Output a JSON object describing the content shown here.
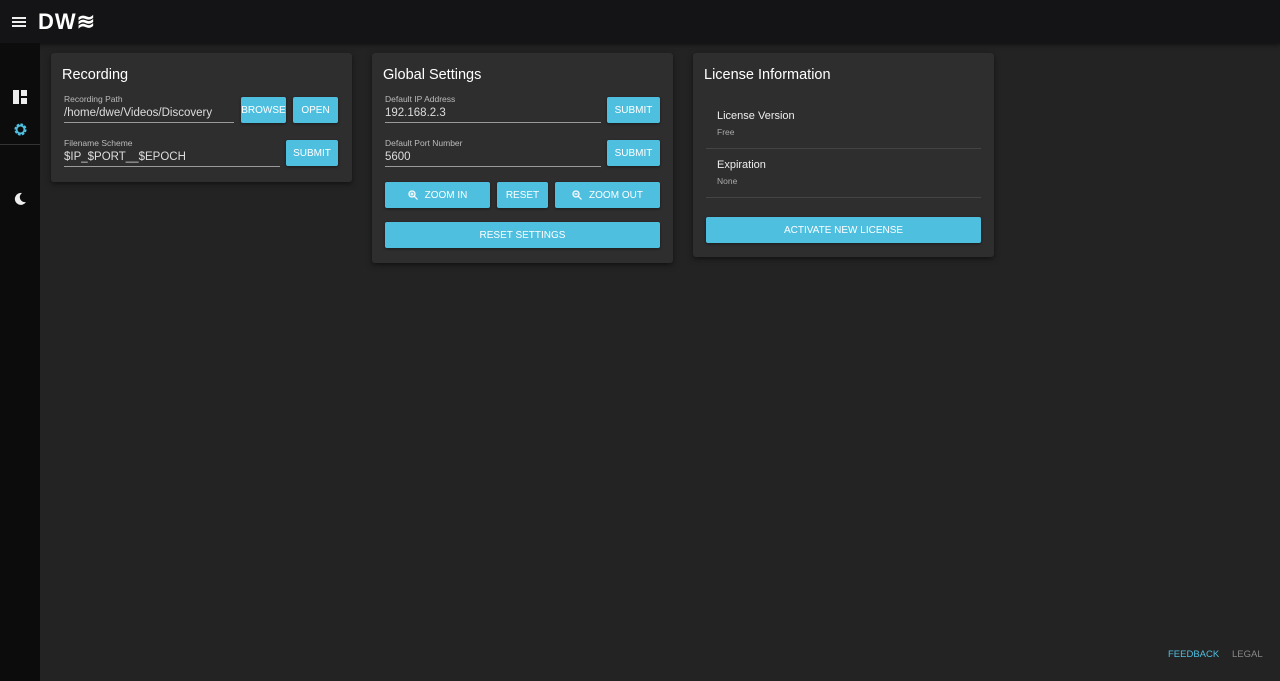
{
  "header": {
    "logo": "DW≋"
  },
  "accent": "#4fbfe0",
  "recording": {
    "title": "Recording",
    "path_label": "Recording Path",
    "path_value": "/home/dwe/Videos/Discovery",
    "browse": "BROWSE",
    "open": "OPEN",
    "scheme_label": "Filename Scheme",
    "scheme_value": "$IP_$PORT__$EPOCH",
    "submit": "SUBMIT"
  },
  "global": {
    "title": "Global Settings",
    "ip_label": "Default IP Address",
    "ip_value": "192.168.2.3",
    "port_label": "Default Port Number",
    "port_value": "5600",
    "submit": "SUBMIT",
    "zoom_in": "ZOOM IN",
    "reset": "RESET",
    "zoom_out": "ZOOM OUT",
    "reset_settings": "RESET SETTINGS"
  },
  "license": {
    "title": "License Information",
    "items": [
      {
        "title": "License Version",
        "value": "Free"
      },
      {
        "title": "Expiration",
        "value": "None"
      }
    ],
    "activate": "ACTIVATE NEW LICENSE"
  },
  "footer": {
    "feedback": "FEEDBACK",
    "legal": "LEGAL"
  }
}
